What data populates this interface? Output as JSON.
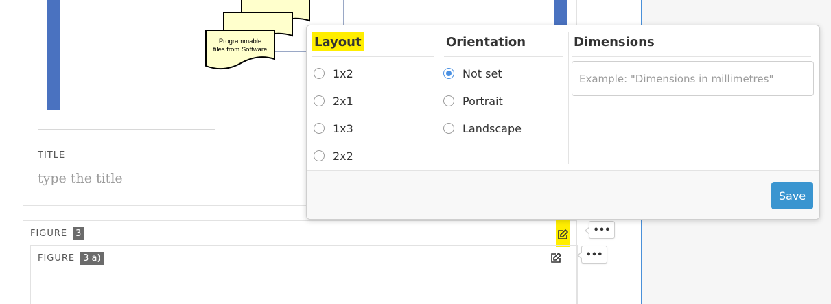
{
  "diagram": {
    "label_line1": "Programmable",
    "label_line2": "files from Software"
  },
  "figure": {
    "title_label": "TITLE",
    "title_placeholder": "type the title"
  },
  "figure3": {
    "label": "FIGURE",
    "number": "3"
  },
  "figure3a": {
    "label": "FIGURE",
    "number": "3 a)"
  },
  "popup": {
    "layout": {
      "heading": "Layout",
      "options": [
        "1x2",
        "2x1",
        "1x3",
        "2x2"
      ],
      "selected": null
    },
    "orientation": {
      "heading": "Orientation",
      "options": [
        "Not set",
        "Portrait",
        "Landscape"
      ],
      "selected": "Not set"
    },
    "dimensions": {
      "heading": "Dimensions",
      "placeholder": "Example: \"Dimensions in millimetres\"",
      "value": ""
    },
    "save_label": "Save"
  },
  "more_label": "•••",
  "colors": {
    "highlight": "#ffee00",
    "accent": "#3a95d0",
    "bar_blue": "#4a72c0"
  }
}
